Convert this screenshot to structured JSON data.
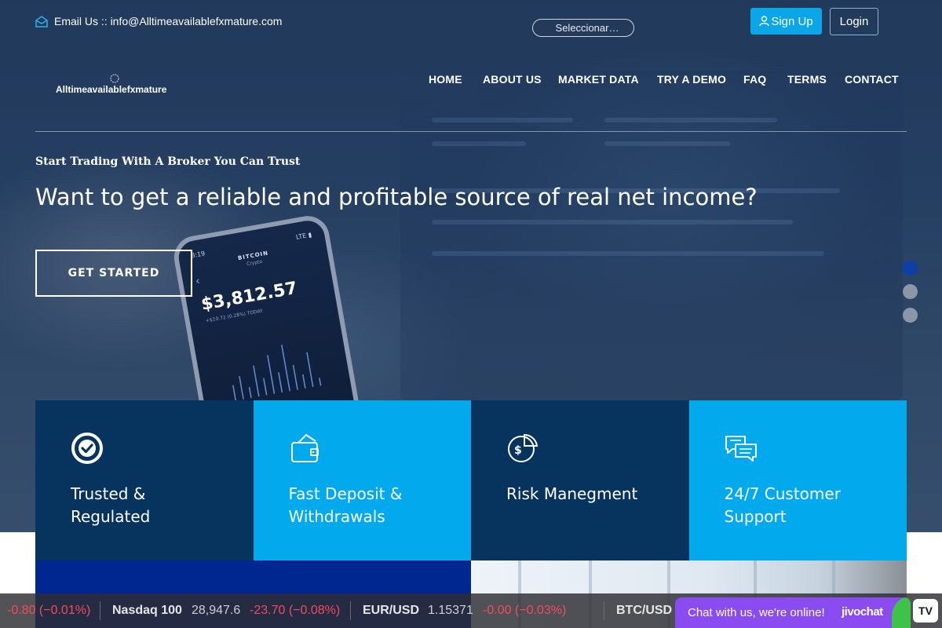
{
  "header": {
    "email_label": "Email Us :: info@Alltimeavailablefxmature.com",
    "language_select": "Seleccionar…",
    "signup_label": "Sign Up",
    "login_label": "Login"
  },
  "logo": {
    "text": "Alltimeavailablefxmature"
  },
  "nav": {
    "items": [
      {
        "label": "HOME"
      },
      {
        "label": "ABOUT US"
      },
      {
        "label": "MARKET DATA"
      },
      {
        "label": "TRY A DEMO"
      },
      {
        "label": "FAQ"
      },
      {
        "label": "TERMS"
      },
      {
        "label": "CONTACT"
      }
    ]
  },
  "hero": {
    "tagline": "Start Trading With A Broker You Can Trust",
    "headline": "Want to get a reliable and profitable source of real net income?",
    "cta_label": "GET STARTED",
    "phone": {
      "time": "3:19",
      "title": "BITCOIN",
      "subtitle": "Crypto",
      "price": "$3,812.57",
      "change": "+$10.72 (0.28%) TODAY"
    },
    "slides": 3,
    "active_slide": 1
  },
  "features": [
    {
      "icon": "check-circle-icon",
      "label": "Trusted & Regulated"
    },
    {
      "icon": "wallet-icon",
      "label": "Fast Deposit & Withdrawals"
    },
    {
      "icon": "pie-chart-dollar-icon",
      "label": "Risk Manegment"
    },
    {
      "icon": "chat-bubbles-icon",
      "label": "24/7 Customer Support"
    }
  ],
  "ticker": {
    "items": [
      {
        "change": "-0.80 (−0.01%)"
      },
      {
        "name": "Nasdaq 100",
        "value": "28,947.6",
        "change": "-23.70 (−0.08%)"
      },
      {
        "name": "EUR/USD",
        "value": "1.15371",
        "change": "-0.00 (−0.03%)"
      },
      {
        "name": "BTC/USD"
      }
    ]
  },
  "chat": {
    "text": "Chat with us, we're online!",
    "brand": "jivochat"
  },
  "tradingview_badge": "TV",
  "colors": {
    "accent_blue": "#0aa6e8",
    "feature_dark": "#07335f",
    "feature_light": "#02a9ec",
    "ticker_negative": "#f44b5a",
    "chat_purple": "#8a4bf0"
  }
}
